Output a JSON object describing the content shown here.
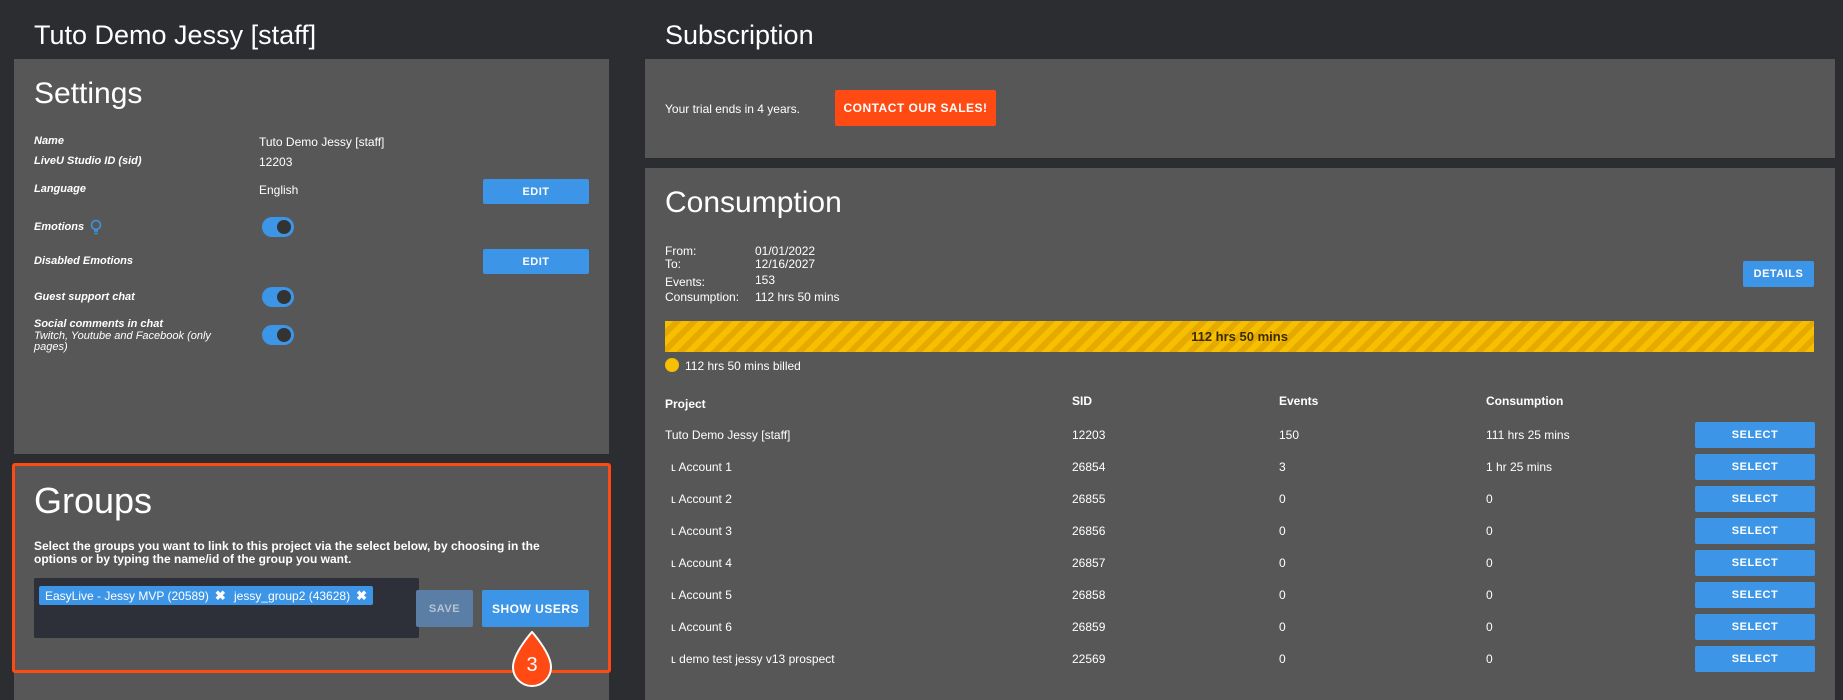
{
  "left": {
    "title": "Tuto Demo Jessy [staff]",
    "settings": {
      "title": "Settings",
      "rows": [
        {
          "label": "Name",
          "value": "Tuto Demo Jessy [staff]"
        },
        {
          "label": "LiveU Studio ID (sid)",
          "value": "12203"
        },
        {
          "label": "Language",
          "value": "English"
        },
        {
          "label": "Emotions",
          "value": ""
        },
        {
          "label": "Disabled Emotions",
          "value": ""
        },
        {
          "label": "Guest support chat",
          "value": ""
        },
        {
          "label": "Social comments in chat",
          "sub": "Twitch, Youtube and Facebook (only pages)"
        }
      ],
      "edit_label": "EDIT",
      "toggles": {
        "emotions": true,
        "guest_support_chat": true,
        "social_comments": true
      }
    },
    "groups": {
      "title": "Groups",
      "description": "Select the groups you want to link to this project via the select below, by choosing in the options or by typing the name/id of the group you want.",
      "tags": [
        "EasyLive - Jessy MVP (20589)",
        "jessy_group2 (43628)"
      ],
      "save_label": "SAVE",
      "show_users_label": "SHOW USERS",
      "callout_number": "3"
    }
  },
  "subscription": {
    "title": "Subscription",
    "trial_text": "Your trial ends in 4 years.",
    "contact_label": "CONTACT OUR SALES!"
  },
  "consumption": {
    "title": "Consumption",
    "info": [
      {
        "label": "From:",
        "value": "01/01/2022"
      },
      {
        "label": "To:",
        "value": "12/16/2027"
      },
      {
        "label": "Events:",
        "value": "153"
      },
      {
        "label": "Consumption:",
        "value": "112 hrs 50 mins"
      }
    ],
    "details_label": "DETAILS",
    "bar_text": "112 hrs 50 mins",
    "bar_fill_fraction": 1.0,
    "legend_text": "112 hrs 50 mins billed",
    "table": {
      "headers": [
        "Project",
        "SID",
        "Events",
        "Consumption"
      ],
      "select_label": "SELECT",
      "rows": [
        {
          "project": "Tuto Demo Jessy [staff]",
          "sid": "12203",
          "events": "150",
          "consumption": "111 hrs 25 mins"
        },
        {
          "project": "ʟ Account 1",
          "sid": "26854",
          "events": "3",
          "consumption": "1 hr 25 mins"
        },
        {
          "project": "ʟ Account 2",
          "sid": "26855",
          "events": "0",
          "consumption": "0"
        },
        {
          "project": "ʟ Account 3",
          "sid": "26856",
          "events": "0",
          "consumption": "0"
        },
        {
          "project": "ʟ Account 4",
          "sid": "26857",
          "events": "0",
          "consumption": "0"
        },
        {
          "project": "ʟ Account 5",
          "sid": "26858",
          "events": "0",
          "consumption": "0"
        },
        {
          "project": "ʟ Account 6",
          "sid": "26859",
          "events": "0",
          "consumption": "0"
        },
        {
          "project": "ʟ demo test jessy v13 prospect",
          "sid": "22569",
          "events": "0",
          "consumption": "0"
        }
      ]
    }
  },
  "colors": {
    "accent": "#3d95e8",
    "contact": "#ff4a14",
    "highlight": "#ff4a14",
    "bar": "#f6c000",
    "panel": "#575757",
    "background": "#2b2d31"
  }
}
